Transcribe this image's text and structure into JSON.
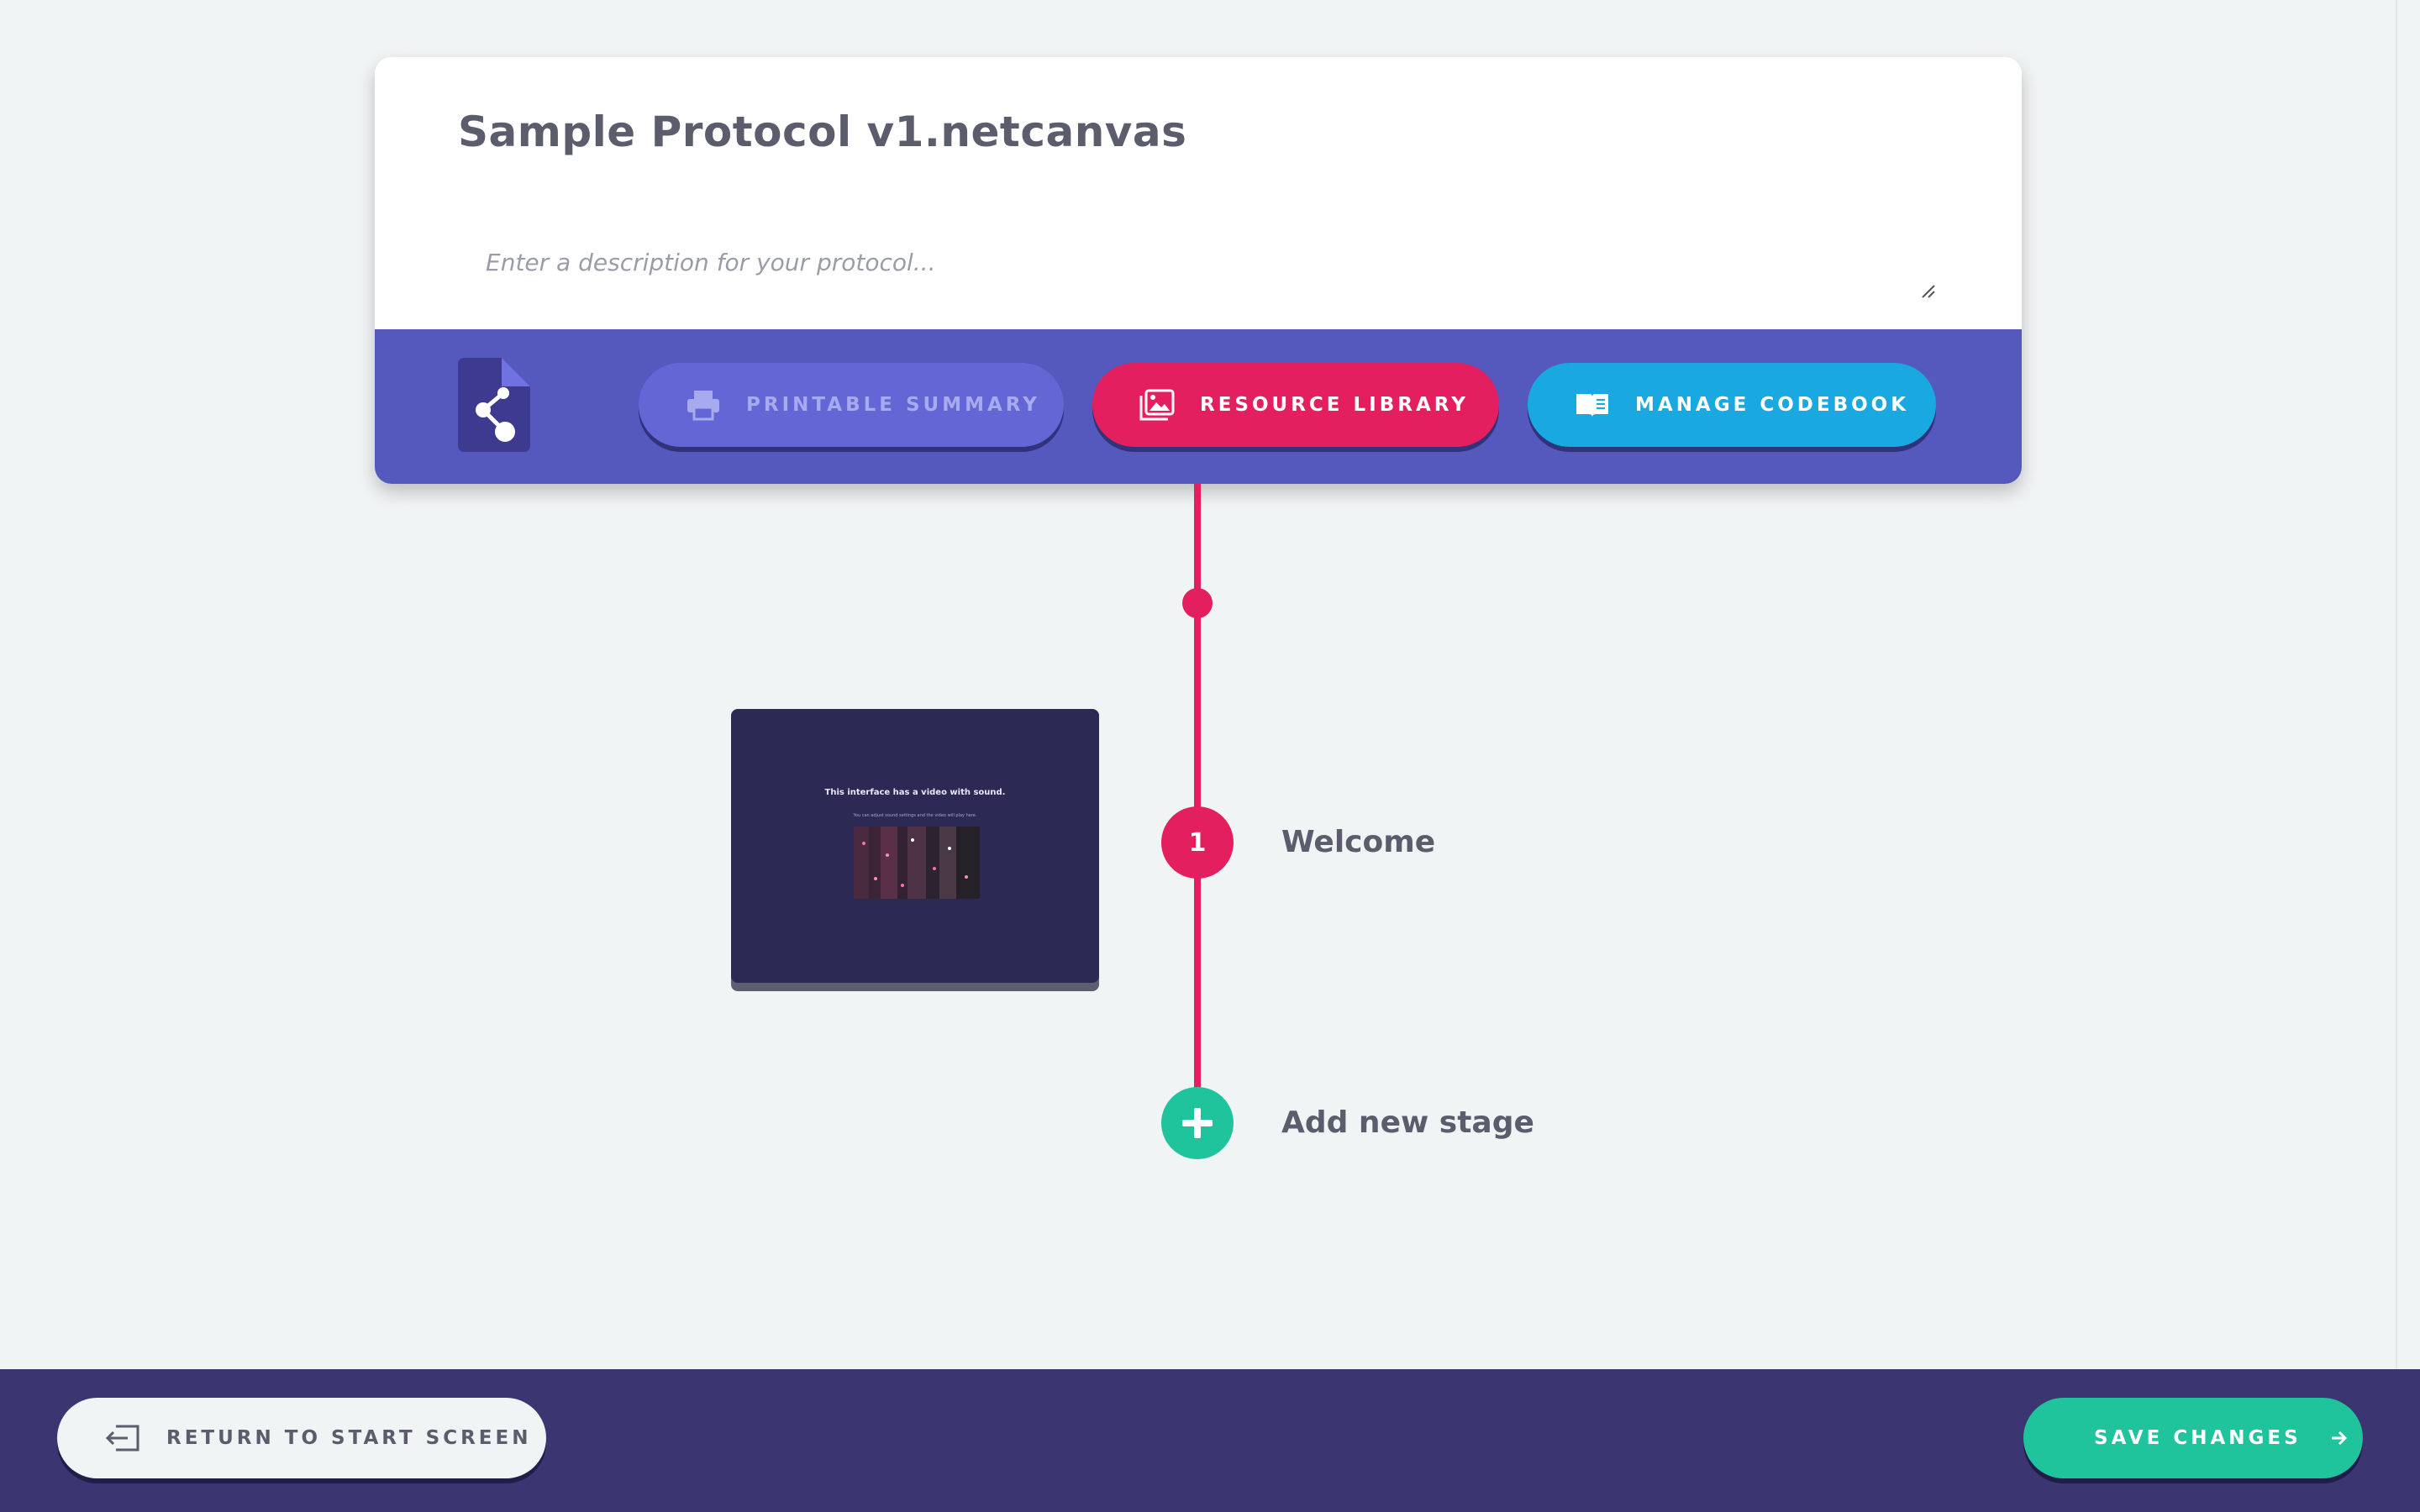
{
  "protocol": {
    "title": "Sample Protocol v1.netcanvas",
    "description_placeholder": "Enter a description for your protocol...",
    "description_value": ""
  },
  "toolbar": {
    "file_icon": "protocol-file-share-icon",
    "printable_summary_label": "PRINTABLE SUMMARY",
    "printable_summary_icon": "printer-icon",
    "resource_library_label": "RESOURCE LIBRARY",
    "resource_library_icon": "image-library-icon",
    "manage_codebook_label": "MANAGE CODEBOOK",
    "manage_codebook_icon": "open-book-icon"
  },
  "timeline": {
    "stages": [
      {
        "number": "1",
        "label": "Welcome",
        "preview": {
          "heading": "This interface has a video with sound.",
          "subtext": "You can adjust sound settings and the video will play here."
        }
      }
    ],
    "add_stage_label": "Add new stage"
  },
  "footer": {
    "return_label": "RETURN TO START SCREEN",
    "return_icon": "exit-arrow-icon",
    "save_label": "SAVE CHANGES",
    "save_icon": "arrow-right-icon"
  },
  "colors": {
    "background": "#f1f4f5",
    "toolbar": "#5558bd",
    "printable": "#6366d4",
    "resource": "#e41f5f",
    "codebook": "#19a8df",
    "timeline": "#e41f5f",
    "add": "#1fc49c",
    "footer": "#3b3671",
    "save": "#1fc49c"
  }
}
